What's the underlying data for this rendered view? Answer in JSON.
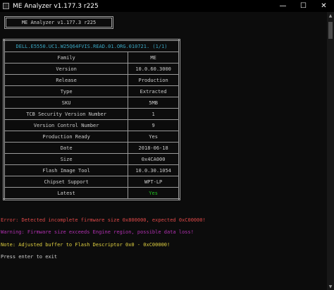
{
  "window": {
    "title": "ME Analyzer v1.177.3 r225",
    "controls": {
      "minimize": "—",
      "maximize": "☐",
      "close": "✕"
    }
  },
  "header": {
    "text": "ME Analyzer v1.177.3 r225"
  },
  "table": {
    "caption": "DELL.E5550.UC1.W25Q64FVIS.READ.01.ORG.010721. (1/1)",
    "rows": [
      {
        "label": "Family",
        "value": "ME"
      },
      {
        "label": "Version",
        "value": "10.0.60.3000"
      },
      {
        "label": "Release",
        "value": "Production"
      },
      {
        "label": "Type",
        "value": "Extracted"
      },
      {
        "label": "SKU",
        "value": "5MB"
      },
      {
        "label": "TCB Security Version Number",
        "value": "1"
      },
      {
        "label": "Version Control Number",
        "value": "9"
      },
      {
        "label": "Production Ready",
        "value": "Yes"
      },
      {
        "label": "Date",
        "value": "2018-06-18"
      },
      {
        "label": "Size",
        "value": "0x4CA000"
      },
      {
        "label": "Flash Image Tool",
        "value": "10.0.30.1054"
      },
      {
        "label": "Chipset Support",
        "value": "WPT-LP"
      },
      {
        "label": "Latest",
        "value": "Yes"
      }
    ]
  },
  "messages": {
    "error": "Error: Detected incomplete firmware size 0x800000, expected 0xC00000!",
    "warning": "Warning: Firmware size exceeds Engine region, possible data loss!",
    "note": "Note: Adjusted buffer to Flash Descriptor 0x0 - 0xC00000!",
    "prompt": "Press enter to exit"
  },
  "colors": {
    "background": "#0c0c0c",
    "caption": "#3aa6c2",
    "latest_yes": "#20c020",
    "error": "#e04848",
    "warning": "#b030b0",
    "note": "#e0d040"
  }
}
